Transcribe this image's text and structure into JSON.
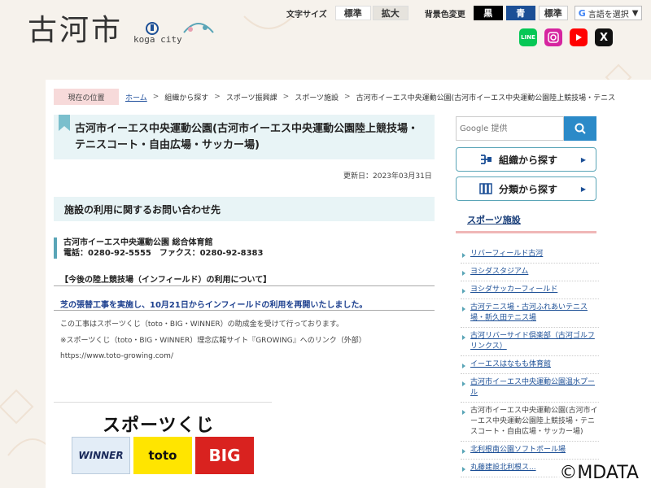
{
  "header": {
    "logo_text": "古河市",
    "logo_sub": "koga city",
    "font_size_label": "文字サイズ",
    "size_standard": "標準",
    "size_large": "拡大",
    "bg_color_label": "背景色変更",
    "bg_black": "黒",
    "bg_blue": "青",
    "bg_standard": "標準",
    "language_button": "言語を選択",
    "sns": [
      {
        "name": "LINE",
        "color": "#06c755"
      },
      {
        "name": "Instagram",
        "color": "#d6249f"
      },
      {
        "name": "YouTube",
        "color": "#ff0000"
      },
      {
        "name": "X",
        "color": "#111111"
      }
    ]
  },
  "breadcrumb": {
    "here": "現在の位置",
    "items": [
      "ホーム",
      "組織から探す",
      "スポーツ振興課",
      "スポーツ施設",
      "古河市イーエス中央運動公園(古河市イーエス中央運動公園陸上競技場・テニス"
    ]
  },
  "main": {
    "title_line1": "古河市イーエス中央運動公園(古河市イーエス中央運動公園陸上競技場・",
    "title_line2": "テニスコート・自由広場・サッカー場)",
    "updated": "更新日：2023年03月31日",
    "section_heading": "施設の利用に関するお問い合わせ先",
    "contact_name": "古河市イーエス中央運動公園 総合体育館",
    "contact_phone": "電話：0280-92-5555　ファクス：0280-92-8383",
    "notice_title": "【今後の陸上競技場（インフィールド）の利用について】",
    "notice_highlight": "芝の張替工事を実施し、10月21日からインフィールドの利用を再開いたしました。",
    "body1": "この工事はスポーツくじ（toto・BIG・WINNER）の助成金を受けて行っております。",
    "body2": "※スポーツくじ（toto・BIG・WINNER）理念広報サイト『GROWING』へのリンク（外部）",
    "body3": "https://www.toto-growing.com/",
    "banner_title": "スポーツくじ",
    "banner_winner": "WINNER",
    "banner_toto": "toto",
    "banner_big": "BIG"
  },
  "sidebar": {
    "search_placeholder": "Google 提供",
    "org_button": "組織から探す",
    "cat_button": "分類から探す",
    "category_heading": "スポーツ施設",
    "items": [
      "リバーフィールド古河",
      "ヨシダスタジアム",
      "ヨシダサッカーフィールド",
      "古河テニス場・古河ふれあいテニス場・新久田テニス場",
      "古河リバーサイド倶楽部（古河ゴルフリンクス）",
      "イーエスはなもも体育館",
      "古河市イーエス中央運動公園温水プール",
      "古河市イーエス中央運動公園(古河市イーエス中央運動公園陸上競技場・テニスコート・自由広場・サッカー場)",
      "北利根南公園ソフトボール場",
      "丸藤建設北利根ス..."
    ]
  },
  "copyright": "©MDATA"
}
